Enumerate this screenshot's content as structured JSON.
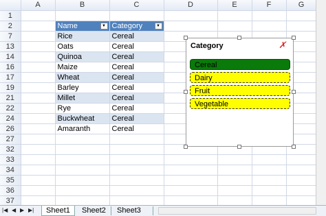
{
  "columns": [
    "A",
    "B",
    "C",
    "D",
    "E",
    "F",
    "G"
  ],
  "table": {
    "header_name": "Name",
    "header_category": "Category",
    "rows": [
      {
        "row": "1",
        "name": "",
        "category": ""
      },
      {
        "row": "2",
        "name": "Name",
        "category": "Category",
        "is_header": true
      },
      {
        "row": "7",
        "name": "Rice",
        "category": "Cereal"
      },
      {
        "row": "13",
        "name": "Oats",
        "category": "Cereal"
      },
      {
        "row": "14",
        "name": "Quinoa",
        "category": "Cereal"
      },
      {
        "row": "16",
        "name": "Maize",
        "category": "Cereal"
      },
      {
        "row": "17",
        "name": "Wheat",
        "category": "Cereal"
      },
      {
        "row": "19",
        "name": "Barley",
        "category": "Cereal"
      },
      {
        "row": "21",
        "name": "Millet",
        "category": "Cereal"
      },
      {
        "row": "22",
        "name": "Rye",
        "category": "Cereal"
      },
      {
        "row": "24",
        "name": "Buckwheat",
        "category": "Cereal"
      },
      {
        "row": "26",
        "name": "Amaranth",
        "category": "Cereal"
      },
      {
        "row": "27",
        "name": "",
        "category": ""
      },
      {
        "row": "32",
        "name": "",
        "category": ""
      },
      {
        "row": "33",
        "name": "",
        "category": ""
      },
      {
        "row": "34",
        "name": "",
        "category": ""
      },
      {
        "row": "35",
        "name": "",
        "category": ""
      },
      {
        "row": "36",
        "name": "",
        "category": ""
      },
      {
        "row": "37",
        "name": "",
        "category": ""
      }
    ]
  },
  "slicer": {
    "title": "Category",
    "clear_glyph": "✗",
    "items": [
      {
        "label": "Cereal",
        "state": "selected",
        "color": "#0a7a0a"
      },
      {
        "label": "Dairy",
        "state": "no-data",
        "color": "#ffff00"
      },
      {
        "label": "Fruit",
        "state": "no-data",
        "color": "#ffff00"
      },
      {
        "label": "Vegetable",
        "state": "no-data",
        "color": "#ffff00"
      }
    ]
  },
  "sheet_tabs": [
    "Sheet1",
    "Sheet2",
    "Sheet3"
  ],
  "active_tab": "Sheet1",
  "nav_glyphs": [
    "|◀",
    "◀",
    "▶",
    "▶|"
  ],
  "colors": {
    "table_header": "#4f81bd",
    "band": "#dbe5f1",
    "grid": "#d0d7e5"
  }
}
